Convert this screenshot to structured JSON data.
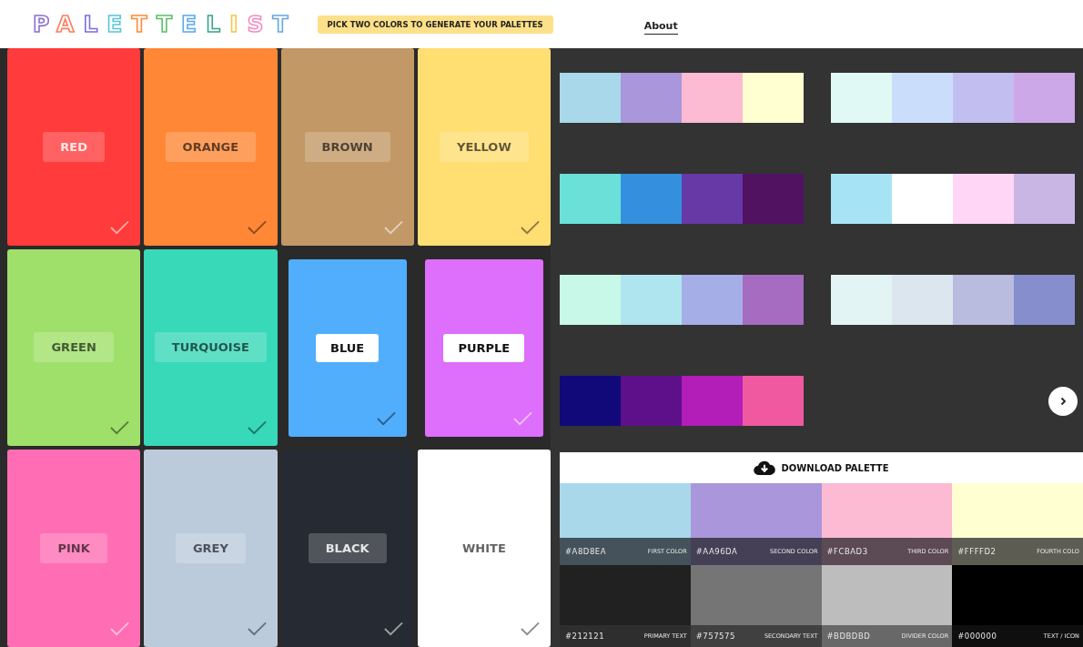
{
  "header": {
    "logo": "PALETTELIST",
    "tagline": "PICK TWO COLORS TO GENERATE YOUR PALETTES",
    "nav": [
      {
        "label": "About"
      }
    ]
  },
  "colors": [
    {
      "label": "RED",
      "color": "#ff3b3b",
      "selected": false
    },
    {
      "label": "ORANGE",
      "color": "#ff8736",
      "selected": false
    },
    {
      "label": "BROWN",
      "color": "#c29866",
      "selected": false
    },
    {
      "label": "YELLOW",
      "color": "#ffde72",
      "selected": false
    },
    {
      "label": "GREEN",
      "color": "#9fe06a",
      "selected": false
    },
    {
      "label": "TURQUOISE",
      "color": "#37d9b8",
      "selected": false
    },
    {
      "label": "BLUE",
      "color": "#50aefc",
      "selected": true
    },
    {
      "label": "PURPLE",
      "color": "#de6efc",
      "selected": true
    },
    {
      "label": "PINK",
      "color": "#ff6eb4",
      "selected": false
    },
    {
      "label": "GREY",
      "color": "#bccbdc",
      "selected": false
    },
    {
      "label": "BLACK",
      "color": "#262a33",
      "selected": false
    },
    {
      "label": "WHITE",
      "color": "#ffffff",
      "selected": false
    }
  ],
  "palettes": [
    {
      "swatches": [
        {
          "color": "#a8d8ea"
        },
        {
          "color": "#aa96da"
        },
        {
          "color": "#fcbad3"
        },
        {
          "color": "#ffffd2"
        }
      ]
    },
    {
      "swatches": [
        {
          "color": "#e0f9f5"
        },
        {
          "color": "#cadefc"
        },
        {
          "color": "#c3bef0"
        },
        {
          "color": "#cca8e9"
        }
      ]
    },
    {
      "swatches": [
        {
          "color": "#6ae0d9"
        },
        {
          "color": "#3490de"
        },
        {
          "color": "#6639a6"
        },
        {
          "color": "#521262"
        }
      ]
    },
    {
      "swatches": [
        {
          "color": "#a6e4f5"
        },
        {
          "color": "#ffffff"
        },
        {
          "color": "#ffd6f5"
        },
        {
          "color": "#c9b6e4"
        }
      ]
    },
    {
      "swatches": [
        {
          "color": "#c8f9e8"
        },
        {
          "color": "#aee5ef"
        },
        {
          "color": "#a6aee8"
        },
        {
          "color": "#a56cc1"
        }
      ]
    },
    {
      "swatches": [
        {
          "color": "#e3f4f4"
        },
        {
          "color": "#dce6ef"
        },
        {
          "color": "#b9bbdf"
        },
        {
          "color": "#878ecd"
        }
      ]
    },
    {
      "swatches": [
        {
          "color": "#11087a"
        },
        {
          "color": "#5e0f8a"
        },
        {
          "color": "#b31db8"
        },
        {
          "color": "#f059a0"
        }
      ]
    }
  ],
  "download": {
    "label": "DOWNLOAD PALETTE",
    "main_colors": [
      {
        "hex": "#A8D8EA",
        "name": "FIRST COLOR",
        "color": "#a8d8ea"
      },
      {
        "hex": "#AA96DA",
        "name": "SECOND COLOR",
        "color": "#aa96da"
      },
      {
        "hex": "#FCBAD3",
        "name": "THIRD COLOR",
        "color": "#fcbad3"
      },
      {
        "hex": "#FFFFD2",
        "name": "FOURTH COLO",
        "color": "#ffffd2"
      }
    ],
    "text_colors": [
      {
        "hex": "#212121",
        "name": "PRIMARY TEXT",
        "color": "#212121"
      },
      {
        "hex": "#757575",
        "name": "SECONDARY TEXT",
        "color": "#757575"
      },
      {
        "hex": "#BDBDBD",
        "name": "DIVIDER COLOR",
        "color": "#bdbdbd"
      },
      {
        "hex": "#000000",
        "name": "TEXT / ICON",
        "color": "#000000"
      }
    ]
  }
}
